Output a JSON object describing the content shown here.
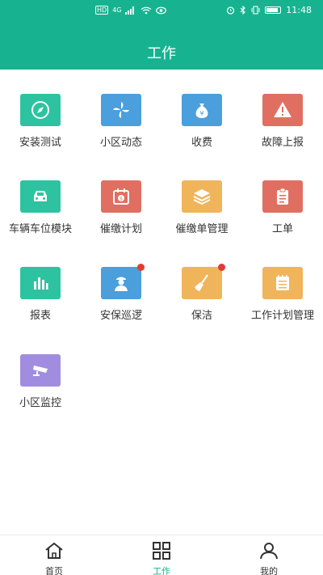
{
  "status_bar": {
    "network": "HD",
    "signal": "4G",
    "time": "11:48"
  },
  "header": {
    "title": "工作"
  },
  "grid": {
    "items": [
      {
        "label": "安装测试",
        "icon": "compass-icon",
        "color": "#2ec3a0",
        "badge": false
      },
      {
        "label": "小区动态",
        "icon": "pinwheel-icon",
        "color": "#4a9fdc",
        "badge": false
      },
      {
        "label": "收费",
        "icon": "money-bag-icon",
        "color": "#4a9fdc",
        "badge": false
      },
      {
        "label": "故障上报",
        "icon": "warning-icon",
        "color": "#e06f62",
        "badge": false
      },
      {
        "label": "车辆车位模块",
        "icon": "car-icon",
        "color": "#2ec3a0",
        "badge": false
      },
      {
        "label": "催缴计划",
        "icon": "calendar-money-icon",
        "color": "#e06f62",
        "badge": false
      },
      {
        "label": "催缴单管理",
        "icon": "layers-icon",
        "color": "#f0b45a",
        "badge": false
      },
      {
        "label": "工单",
        "icon": "clipboard-icon",
        "color": "#e06f62",
        "badge": false
      },
      {
        "label": "报表",
        "icon": "bar-chart-icon",
        "color": "#2ec3a0",
        "badge": false
      },
      {
        "label": "安保巡逻",
        "icon": "security-guard-icon",
        "color": "#4a9fdc",
        "badge": true
      },
      {
        "label": "保洁",
        "icon": "broom-icon",
        "color": "#f0b45a",
        "badge": true
      },
      {
        "label": "工作计划管理",
        "icon": "notepad-icon",
        "color": "#f0b45a",
        "badge": false
      },
      {
        "label": "小区监控",
        "icon": "cctv-camera-icon",
        "color": "#a18ddf",
        "badge": false
      }
    ]
  },
  "tabbar": {
    "tabs": [
      {
        "label": "首页",
        "icon": "home-icon",
        "active": false
      },
      {
        "label": "工作",
        "icon": "grid-icon",
        "active": true
      },
      {
        "label": "我的",
        "icon": "user-icon",
        "active": false
      }
    ],
    "accent": "#17b391"
  }
}
